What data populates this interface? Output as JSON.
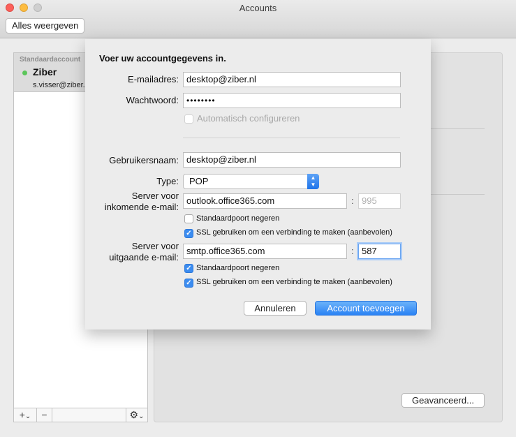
{
  "window": {
    "title": "Accounts",
    "show_all_label": "Alles weergeven"
  },
  "account_list": {
    "group_label": "Standaardaccount",
    "selected": {
      "name": "Ziber",
      "email": "s.visser@ziber.nl",
      "status_color": "#5bc65a"
    },
    "toolbar": {
      "add": "+",
      "add_menu": "⌄",
      "remove": "−",
      "gear": "⚙",
      "gear_menu": "⌄"
    }
  },
  "right_pane": {
    "advanced_button": "Geavanceerd..."
  },
  "sheet": {
    "title": "Voer uw accountgegevens in.",
    "email": {
      "label": "E-mailadres:",
      "value": "desktop@ziber.nl"
    },
    "password": {
      "label": "Wachtwoord:",
      "value": "••••••••"
    },
    "auto_config": {
      "label": "Automatisch configureren",
      "checked": false,
      "disabled": true
    },
    "username": {
      "label": "Gebruikersnaam:",
      "value": "desktop@ziber.nl"
    },
    "type": {
      "label": "Type:",
      "value": "POP"
    },
    "incoming": {
      "label_line1": "Server voor",
      "label_line2": "inkomende e-mail:",
      "server": "outlook.office365.com",
      "port": "995",
      "override_port": {
        "label": "Standaardpoort negeren",
        "checked": false
      },
      "ssl": {
        "label": "SSL gebruiken om een verbinding te maken (aanbevolen)",
        "checked": true
      }
    },
    "outgoing": {
      "label_line1": "Server voor",
      "label_line2": "uitgaande e-mail:",
      "server": "smtp.office365.com",
      "port": "587",
      "override_port": {
        "label": "Standaardpoort negeren",
        "checked": true
      },
      "ssl": {
        "label": "SSL gebruiken om een verbinding te maken (aanbevolen)",
        "checked": true
      }
    },
    "cancel_button": "Annuleren",
    "add_button": "Account toevoegen"
  },
  "colors": {
    "accent": "#2a82f4",
    "checkbox_checked": "#3b8cf0"
  }
}
